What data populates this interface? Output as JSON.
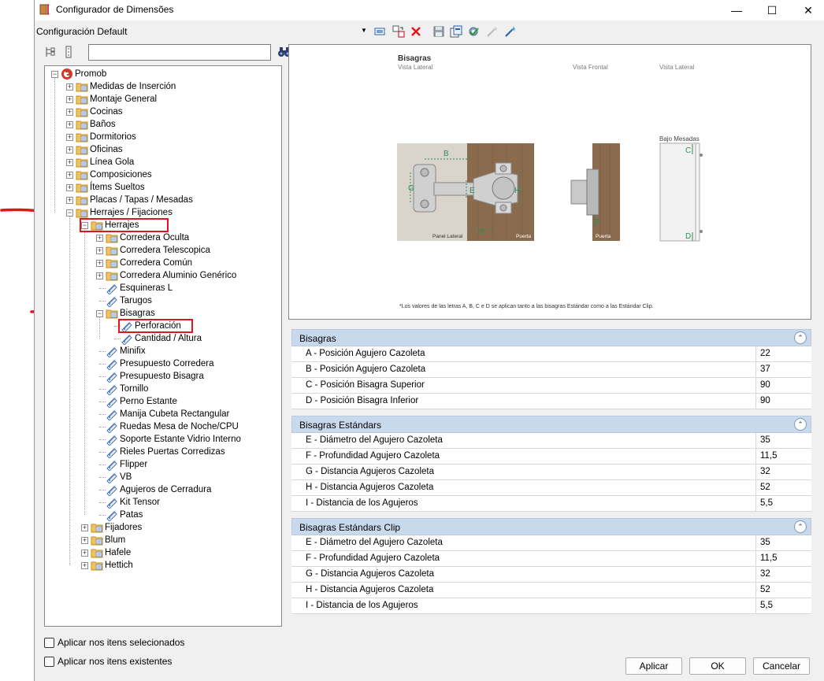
{
  "window": {
    "title": "Configurador de Dimensões",
    "minimize_glyph": "—",
    "maximize_glyph": "☐",
    "close_glyph": "✕"
  },
  "config_bar": {
    "label": "Configuración Default",
    "icons": [
      "screen-icon",
      "transfer-icon",
      "delete-icon",
      "save-icon",
      "export-icon",
      "settings-check-icon",
      "wand-disabled-icon",
      "wand-icon"
    ]
  },
  "tree": {
    "search_value": "",
    "root": "Promob",
    "level1": [
      "Medidas de Inserción",
      "Montaje General",
      "Cocinas",
      "Baños",
      "Dormitorios",
      "Oficinas",
      "Línea Gola",
      "Composiciones",
      "Ítems Sueltos",
      "Placas / Tapas / Mesadas",
      "Herrajes / Fijaciones"
    ],
    "herrajes": "Herrajes",
    "herrajes_folders": [
      "Corredera Oculta",
      "Corredera Telescopica",
      "Corredera Común",
      "Corredera Aluminio Genérico"
    ],
    "herrajes_items_a": [
      "Esquineras L",
      "Tarugos"
    ],
    "bisagras": "Bisagras",
    "bisagras_items": [
      "Perforación",
      "Cantidad / Altura"
    ],
    "herrajes_items_b": [
      "Minifix",
      "Presupuesto Corredera",
      "Presupuesto Bisagra",
      "Tornillo",
      "Perno Estante",
      "Manija Cubeta Rectangular",
      "Ruedas Mesa de Noche/CPU",
      "Soporte Estante Vidrio Interno",
      "Rieles Puertas Corredizas",
      "Flipper",
      "VB",
      "Agujeros de Cerradura",
      "Kit Tensor",
      "Patas"
    ],
    "level2_tail": [
      "Fijadores",
      "Blum",
      "Hafele",
      "Hettich"
    ]
  },
  "checks": {
    "apply_selected": "Aplicar nos itens selecionados",
    "apply_existing": "Aplicar nos itens existentes"
  },
  "preview": {
    "title": "Bisagras",
    "sub_lateral": "Vista Lateral",
    "sub_frontal": "Vista Frontal",
    "sub_lateral2": "Vista Lateral",
    "bajo_mesadas": "Bajo Mesadas",
    "panel_lateral": "Panel Lateral",
    "puerta": "Puerta",
    "puerta2": "Puerta",
    "letters": {
      "a": "A",
      "b": "B",
      "c": "C",
      "d": "D",
      "e": "E",
      "f": "F",
      "g": "G",
      "h": "H"
    },
    "note": "*Los valores de las letras A, B, C e D se aplican tanto a las bisagras Estándar como a las Estándar Clip."
  },
  "sections": [
    {
      "title": "Bisagras",
      "rows": [
        {
          "label": "A - Posición Agujero Cazoleta",
          "value": "22"
        },
        {
          "label": "B - Posición Agujero Cazoleta",
          "value": "37"
        },
        {
          "label": "C - Posición Bisagra Superior",
          "value": "90"
        },
        {
          "label": "D - Posición Bisagra Inferior",
          "value": "90"
        }
      ]
    },
    {
      "title": "Bisagras Estándars",
      "rows": [
        {
          "label": "E - Diámetro del Agujero Cazoleta",
          "value": "35"
        },
        {
          "label": "F - Profundidad Agujero Cazoleta",
          "value": "11,5"
        },
        {
          "label": "G - Distancia Agujeros Cazoleta",
          "value": "32"
        },
        {
          "label": "H - Distancia Agujeros Cazoleta",
          "value": "52"
        },
        {
          "label": "I - Distancia de los Agujeros",
          "value": "5,5"
        }
      ]
    },
    {
      "title": "Bisagras Estándars Clip",
      "rows": [
        {
          "label": "E - Diámetro del Agujero Cazoleta",
          "value": "35"
        },
        {
          "label": "F - Profundidad Agujero Cazoleta",
          "value": "11,5"
        },
        {
          "label": "G - Distancia Agujeros Cazoleta",
          "value": "32"
        },
        {
          "label": "H - Distancia Agujeros Cazoleta",
          "value": "52"
        },
        {
          "label": "I - Distancia de los Agujeros",
          "value": "5,5"
        }
      ]
    }
  ],
  "collapse_glyph": "⌃",
  "buttons": {
    "apply": "Aplicar",
    "ok": "OK",
    "cancel": "Cancelar"
  },
  "colors": {
    "highlight": "#e0161b",
    "section_header": "#c9d9ec",
    "folder": "#f2c25c",
    "wood": "#8b6b4e",
    "dim_green": "#2e8b57"
  }
}
